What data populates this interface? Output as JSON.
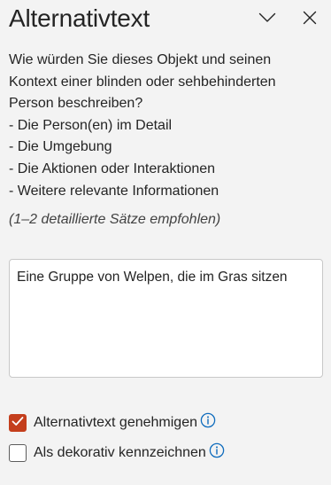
{
  "pane": {
    "title": "Alternativtext",
    "collapse_icon": "chevron-down-icon",
    "close_icon": "close-icon"
  },
  "description": {
    "lines": [
      "Wie würden Sie dieses Objekt und seinen",
      "Kontext einer blinden oder sehbehinderten",
      "Person beschreiben?",
      "- Die Person(en) im Detail",
      "- Die Umgebung",
      "- Die Aktionen oder Interaktionen",
      "- Weitere relevante Informationen"
    ],
    "hint": "(1–2 detaillierte Sätze empfohlen)"
  },
  "alt_text": {
    "value": "Eine Gruppe von Welpen, die im Gras sitzen"
  },
  "options": {
    "approve": {
      "label": "Alternativtext genehmigen",
      "checked": true
    },
    "decorative": {
      "label": "Als dekorativ kennzeichnen",
      "checked": false
    },
    "info_icon": "info-icon"
  },
  "colors": {
    "accent": "#c43e1c",
    "info": "#0f6cbd",
    "background": "#f3f3f3"
  }
}
